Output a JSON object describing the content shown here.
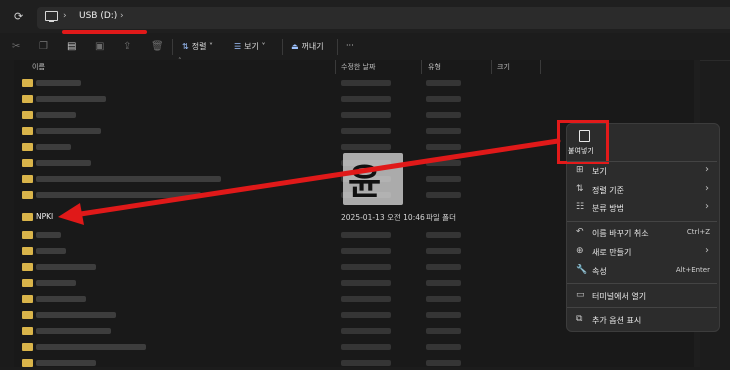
{
  "address": {
    "refresh_icon": "refresh-icon",
    "drive_label": "USB (D:)"
  },
  "toolbar": {
    "sort_label": "정렬",
    "view_label": "보기",
    "eject_label": "꺼내기",
    "more_label": "···"
  },
  "columns": {
    "name": "이름",
    "date": "수정한 날짜",
    "type": "유형",
    "size": "크기"
  },
  "npki_folder": {
    "name": "NPKI",
    "date": "2025-01-13 오전 10:46",
    "type": "파일 폴더"
  },
  "context_menu": {
    "paste_label": "붙여넣기",
    "items": [
      {
        "label": "보기",
        "icon": "grid-icon",
        "shortcut": ""
      },
      {
        "label": "정렬 기준",
        "icon": "sort-icon",
        "shortcut": ""
      },
      {
        "label": "분류 방법",
        "icon": "group-icon",
        "shortcut": ""
      },
      {
        "label": "이름 바꾸기 취소",
        "icon": "undo-icon",
        "shortcut": "Ctrl+Z"
      },
      {
        "label": "새로 만들기",
        "icon": "new-icon",
        "shortcut": ""
      },
      {
        "label": "속성",
        "icon": "wrench-icon",
        "shortcut": "Alt+Enter"
      },
      {
        "label": "터미널에서 열기",
        "icon": "terminal-icon",
        "shortcut": ""
      },
      {
        "label": "추가 옵션 표시",
        "icon": "more-options-icon",
        "shortcut": ""
      }
    ]
  },
  "watermark_text": "윤",
  "colors": {
    "annotation_red": "#e01919",
    "folder_yellow": "#d9b44a"
  }
}
